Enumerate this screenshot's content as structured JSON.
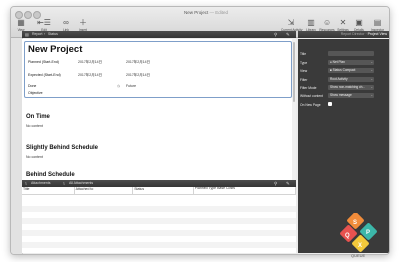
{
  "window": {
    "title": "New Project",
    "status": "Edited"
  },
  "toolbar": {
    "left": [
      {
        "label": "View",
        "icon": "grid-view-icon"
      },
      {
        "label": "Edit",
        "icon": "outline-edit-icon"
      },
      {
        "label": "Link",
        "icon": "link-icon"
      },
      {
        "label": "Insert",
        "icon": "plus-icon"
      }
    ],
    "right": [
      {
        "label": "Current Activity",
        "icon": "activity-icon"
      },
      {
        "label": "Library",
        "icon": "library-icon"
      },
      {
        "label": "Resources",
        "icon": "people-icon"
      },
      {
        "label": "Settings",
        "icon": "gear-icon"
      },
      {
        "label": "Details",
        "icon": "details-icon"
      },
      {
        "label": "Inspector",
        "icon": "inspector-icon"
      }
    ]
  },
  "main_header": {
    "breadcrumb": [
      "Report",
      "Status"
    ]
  },
  "report": {
    "title": "New Project",
    "fields": [
      {
        "label": "Planned (Start-End)",
        "start": "2017年2月14日",
        "end": "2017年2月14日"
      },
      {
        "label": "Expected (Start-End)",
        "start": "2017年2月14日",
        "end": "2017年2月14日"
      },
      {
        "label": "Done",
        "start": "",
        "end": "Future"
      },
      {
        "label": "Objective",
        "start": "",
        "end": ""
      }
    ],
    "sections": [
      {
        "title": "On Time",
        "content": "No content"
      },
      {
        "title": "Slightly Behind Schedule",
        "content": "No content"
      },
      {
        "title": "Behind Schedule",
        "content": ""
      }
    ]
  },
  "attachments": {
    "tabs": [
      "Attachments",
      "All Attachments"
    ],
    "columns": [
      "Title",
      "Attached to",
      "Status",
      "Planned Type  Base Costs"
    ]
  },
  "inspector": {
    "header": "Report Director",
    "title": "Project View",
    "rows": [
      {
        "label": "Title",
        "value": ""
      },
      {
        "label": "Type",
        "value": "Net Plan"
      },
      {
        "label": "View",
        "value": "Status Compact"
      },
      {
        "label": "Filter",
        "value": "Root Activity"
      },
      {
        "label": "Filter Mode",
        "value": "Show non-matching ch..."
      },
      {
        "label": "Without content",
        "value": "Show message"
      },
      {
        "label": "On New Page",
        "value": ""
      }
    ]
  },
  "colors": {
    "inspector_bg": "#3a3a3a",
    "selection_border": "#7f9fc9",
    "logo_orange": "#f18c3a",
    "logo_red": "#e7524f",
    "logo_yellow": "#f3c93b",
    "logo_teal": "#3cb7a9"
  }
}
